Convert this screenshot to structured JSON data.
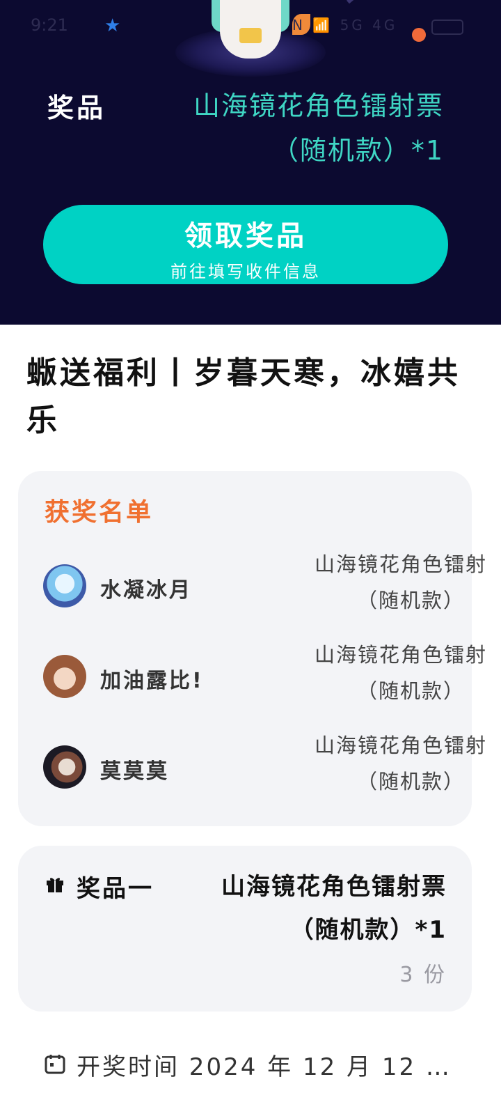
{
  "status_bar": {
    "time": "9:21",
    "icons": "N 📶 5G 4G",
    "accent_star": "★"
  },
  "hero": {
    "prize_label": "奖品",
    "prize_name": "山海镜花角色镭射票（随机款）*1",
    "claim_button": {
      "title": "领取奖品",
      "subtitle": "前往填写收件信息"
    },
    "colors": {
      "background": "#0c0a30",
      "accent": "#00d2c4",
      "prize_text": "#3fd6c4"
    }
  },
  "page_title": "蝂送福利丨岁暮天寒，冰嬉共乐",
  "winners": {
    "title": "获奖名单",
    "title_color": "#f07030",
    "items": [
      {
        "name": "水凝冰月",
        "prize_line1": "山海镜花角色镭射",
        "prize_line2": "（随机款）"
      },
      {
        "name": "加油露比!",
        "prize_line1": "山海镜花角色镭射",
        "prize_line2": "（随机款）"
      },
      {
        "name": "莫莫莫",
        "prize_line1": "山海镜花角色镭射",
        "prize_line2": "（随机款）"
      }
    ]
  },
  "prize_card": {
    "label": "奖品一",
    "name": "山海镜花角色镭射票（随机款）*1",
    "count": "3 份"
  },
  "draw_time": {
    "text": "开奖时间 2024 年 12 月 12 …"
  }
}
